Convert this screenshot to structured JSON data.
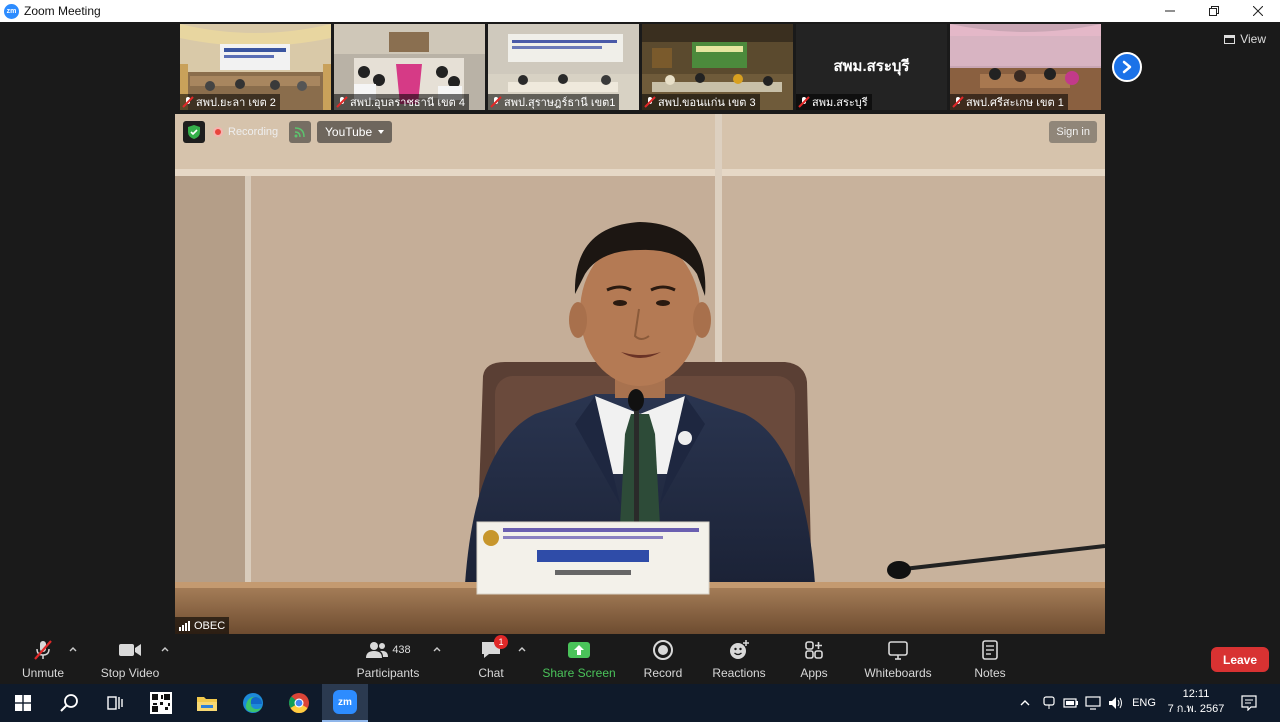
{
  "window": {
    "title": "Zoom Meeting",
    "app_icon_text": "zm",
    "controls": [
      "minimize",
      "restore",
      "close"
    ]
  },
  "gallery": {
    "thumbnails": [
      {
        "label": "สพป.ยะลา เขต 2",
        "muted": true
      },
      {
        "label": "สพป.อุบลราชธานี เขต 4",
        "muted": true
      },
      {
        "label": "สพป.สุราษฎร์ธานี เขต1",
        "muted": true
      },
      {
        "label": "สพป.ขอนแก่น เขต 3",
        "muted": true
      },
      {
        "label": "สพม.สระบุรี",
        "muted": true,
        "video_off": true,
        "display_name": "สพม.สระบุรี"
      },
      {
        "label": "สพป.ศรีสะเกษ เขต 1",
        "muted": true
      }
    ],
    "next_icon": "chevron-right-icon",
    "view_label": "View"
  },
  "main_video": {
    "security_icon": "shield-icon",
    "recording_label": "Recording",
    "live_icon": "live-stream-icon",
    "stream_label": "YouTube",
    "signin_label": "Sign in",
    "participant_name": "OBEC"
  },
  "toolbar": {
    "unmute": "Unmute",
    "stop_video": "Stop Video",
    "participants": "Participants",
    "participants_count": "438",
    "chat": "Chat",
    "chat_badge": "1",
    "share_screen": "Share Screen",
    "record": "Record",
    "reactions": "Reactions",
    "apps": "Apps",
    "whiteboards": "Whiteboards",
    "notes": "Notes",
    "leave": "Leave",
    "share_color": "#4ac35a",
    "leave_color": "#d83232"
  },
  "taskbar": {
    "apps": [
      "windows-start-icon",
      "search-icon",
      "task-view-icon",
      "qr-app-icon",
      "file-explorer-icon",
      "edge-icon",
      "chrome-icon",
      "zoom-icon"
    ],
    "zoom_icon_text": "zm",
    "language": "ENG",
    "time": "12:11",
    "date": "7 ก.พ. 2567"
  }
}
